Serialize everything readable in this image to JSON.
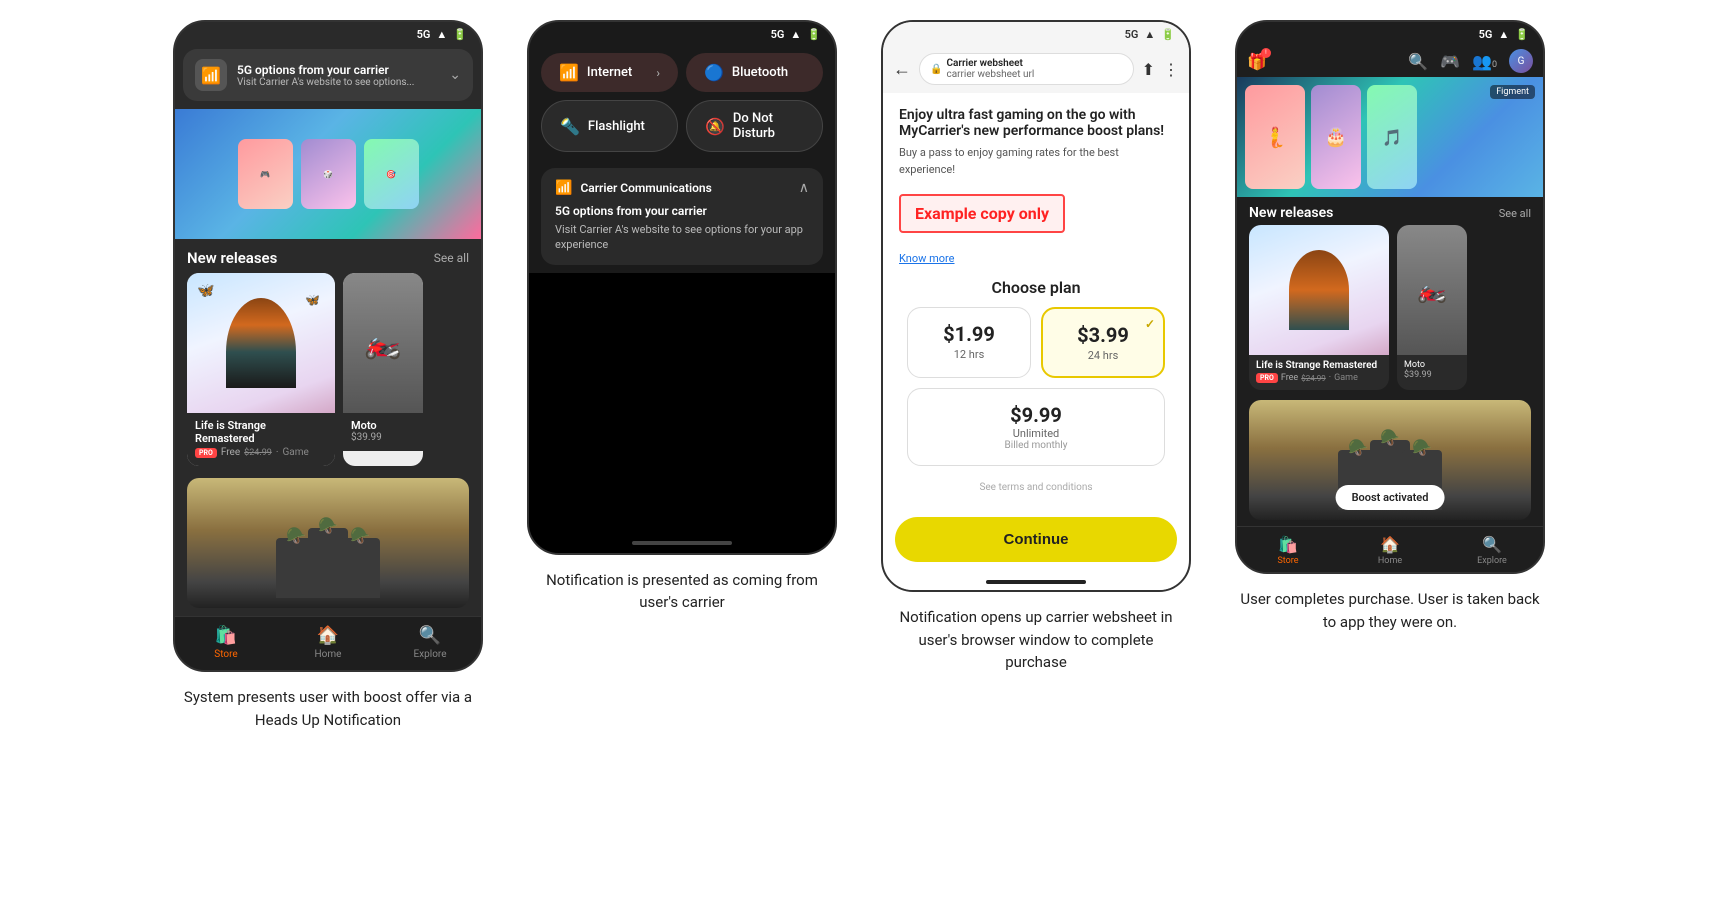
{
  "screen1": {
    "status": "5G",
    "notification": {
      "title": "5G options from your carrier",
      "subtitle": "Visit Carrier A's website to see options..."
    },
    "section": "New releases",
    "see_all": "See all",
    "games": [
      {
        "title": "Life is Strange Remastered",
        "pro": "PRO",
        "price_free": "Free",
        "price_strike": "$24.99",
        "type": "Game"
      },
      {
        "title": "Moto",
        "price": "$39.99"
      }
    ],
    "nav": [
      {
        "label": "Store",
        "active": true
      },
      {
        "label": "Home",
        "active": false
      },
      {
        "label": "Explore",
        "active": false
      }
    ]
  },
  "screen2": {
    "status": "5G",
    "tiles": [
      {
        "label": "Internet",
        "icon": "wifi",
        "has_arrow": true
      },
      {
        "label": "Bluetooth",
        "icon": "bluetooth"
      },
      {
        "label": "Flashlight",
        "icon": "flashlight"
      },
      {
        "label": "Do Not Disturb",
        "icon": "dnd"
      }
    ],
    "carrier_notif": {
      "name": "Carrier Communications",
      "title": "5G options from your carrier",
      "body": "Visit Carrier A's website to see options for your app experience"
    }
  },
  "screen3": {
    "status": "5G",
    "url": "carrier websheet url",
    "browser_title": "Carrier websheet",
    "body_text": "Enjoy ultra fast gaming on the go with MyCarrier's new performance boost plans!",
    "body_partial": "Buy a pass to enjoy gaming rates for the best experience!",
    "know_more": "Know more",
    "example_text": "Example copy only",
    "plan_title": "Choose plan",
    "plans": [
      {
        "price": "$1.99",
        "duration": "12 hrs",
        "selected": false
      },
      {
        "price": "$3.99",
        "duration": "24 hrs",
        "selected": true
      },
      {
        "price": "$9.99",
        "duration": "Unlimited",
        "billing": "Billed monthly",
        "selected": false
      }
    ],
    "terms": "See terms and conditions",
    "continue_btn": "Continue"
  },
  "screen4": {
    "status": "5G",
    "section": "New releases",
    "see_all": "See all",
    "games": [
      {
        "title": "Life is Strange Remastered",
        "pro": "PRO",
        "price_free": "Free",
        "price_strike": "$24.99",
        "type": "Game"
      },
      {
        "title": "Moto",
        "price": "$39.99"
      }
    ],
    "boost_pill": "Boost activated",
    "nav": [
      {
        "label": "Store",
        "active": true
      },
      {
        "label": "Home",
        "active": false
      },
      {
        "label": "Explore",
        "active": false
      }
    ]
  },
  "captions": [
    "System presents user with boost offer via a Heads Up Notification",
    "Notification is presented as coming from user's carrier",
    "Notification opens up carrier websheet in user's browser window to complete purchase",
    "User completes purchase. User is taken back to app they were on."
  ]
}
